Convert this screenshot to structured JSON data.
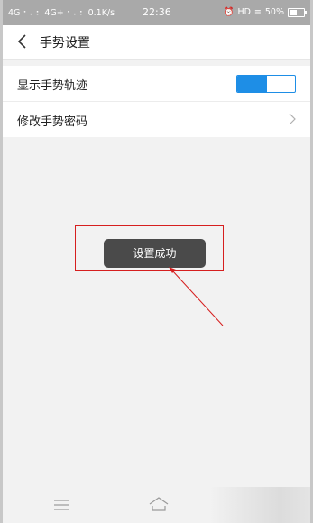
{
  "status_bar": {
    "left_text": "4G ⠂⠄⠆ 4G+ ⠂⠄⠆ 0.1K/s",
    "time": "22:36",
    "right_text": "HD",
    "battery": "50%"
  },
  "header": {
    "title": "手势设置",
    "back_icon": "chevron-left-icon"
  },
  "settings": {
    "items": [
      {
        "label": "显示手势轨迹",
        "control": "toggle",
        "toggle_on": true
      },
      {
        "label": "修改手势密码",
        "control": "chevron"
      }
    ]
  },
  "toast": {
    "text": "设置成功"
  },
  "annotation": {
    "box_color": "#d61f1f",
    "arrow_color": "#d61f1f"
  },
  "colors": {
    "accent": "#1e8ee6",
    "status_bar_bg": "#a9a9a9",
    "toast_bg": "#4a4a4a"
  },
  "nav_bar": {
    "icons": [
      "menu-icon",
      "home-icon"
    ]
  }
}
